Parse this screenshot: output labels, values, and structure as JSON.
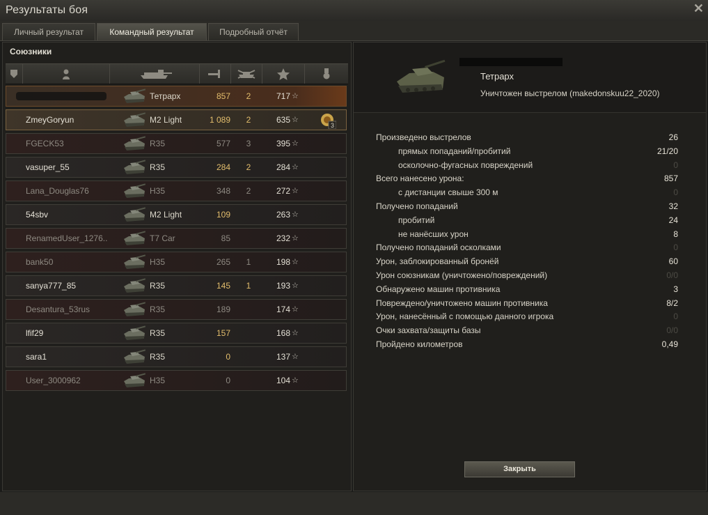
{
  "window": {
    "title": "Результаты боя",
    "close_glyph": "✕"
  },
  "tabs": [
    {
      "label": "Личный результат",
      "active": false
    },
    {
      "label": "Командный результат",
      "active": true
    },
    {
      "label": "Подробный отчёт",
      "active": false
    }
  ],
  "team": {
    "title": "Союзники",
    "columns": [
      "squad-icon",
      "player-icon",
      "tank-icon",
      "damage-icon",
      "kills-icon",
      "xp-icon",
      "medal-icon"
    ],
    "sort_glyph": "⌄",
    "star_glyph": "☆",
    "rows": [
      {
        "name": "",
        "tank": "Тетрарх",
        "damage": "857",
        "kills": "2",
        "xp": "717",
        "state": "self"
      },
      {
        "name": "ZmeyGoryun",
        "tank": "M2 Light",
        "damage": "1 089",
        "kills": "2",
        "xp": "635",
        "state": "hl",
        "medal": "3"
      },
      {
        "name": "FGECK53",
        "tank": "R35",
        "damage": "577",
        "kills": "3",
        "xp": "395",
        "state": "dead"
      },
      {
        "name": "vasuper_55",
        "tank": "R35",
        "damage": "284",
        "kills": "2",
        "xp": "284",
        "state": "alive"
      },
      {
        "name": "Lana_Douglas76",
        "tank": "H35",
        "damage": "348",
        "kills": "2",
        "xp": "272",
        "state": "dead"
      },
      {
        "name": "54sbv",
        "tank": "M2 Light",
        "damage": "109",
        "kills": "",
        "xp": "263",
        "state": "alive"
      },
      {
        "name": "RenamedUser_1276..",
        "tank": "T7 Car",
        "damage": "85",
        "kills": "",
        "xp": "232",
        "state": "dead"
      },
      {
        "name": "bank50",
        "tank": "H35",
        "damage": "265",
        "kills": "1",
        "xp": "198",
        "state": "dead"
      },
      {
        "name": "sanya777_85",
        "tank": "R35",
        "damage": "145",
        "kills": "1",
        "xp": "193",
        "state": "alive"
      },
      {
        "name": "Desantura_53rus",
        "tank": "R35",
        "damage": "189",
        "kills": "",
        "xp": "174",
        "state": "dead"
      },
      {
        "name": "lfif29",
        "tank": "R35",
        "damage": "157",
        "kills": "",
        "xp": "168",
        "state": "alive"
      },
      {
        "name": "sara1",
        "tank": "R35",
        "damage": "0",
        "kills": "",
        "xp": "137",
        "state": "alive"
      },
      {
        "name": "User_3000962",
        "tank": "H35",
        "damage": "0",
        "kills": "",
        "xp": "104",
        "state": "dead"
      }
    ]
  },
  "detail": {
    "vehicle": "Тетрарх",
    "status": "Уничтожен выстрелом (makedonskuu22_2020)",
    "stats": [
      {
        "label": "Произведено выстрелов",
        "value": "26",
        "indent": false,
        "dim": false
      },
      {
        "label": "прямых попаданий/пробитий",
        "value": "21/20",
        "indent": true,
        "dim": false
      },
      {
        "label": "осколочно-фугасных повреждений",
        "value": "0",
        "indent": true,
        "dim": true
      },
      {
        "label": "Всего нанесено урона:",
        "value": "857",
        "indent": false,
        "dim": false
      },
      {
        "label": "с дистанции свыше 300 м",
        "value": "0",
        "indent": true,
        "dim": true
      },
      {
        "label": "Получено попаданий",
        "value": "32",
        "indent": false,
        "dim": false
      },
      {
        "label": "пробитий",
        "value": "24",
        "indent": true,
        "dim": false
      },
      {
        "label": "не нанёсших урон",
        "value": "8",
        "indent": true,
        "dim": false
      },
      {
        "label": "Получено попаданий осколками",
        "value": "0",
        "indent": false,
        "dim": true
      },
      {
        "label": "Урон, заблокированный бронёй",
        "value": "60",
        "indent": false,
        "dim": false
      },
      {
        "label": "Урон союзникам (уничтожено/повреждений)",
        "value": "0/0",
        "indent": false,
        "dim": true
      },
      {
        "label": "Обнаружено машин противника",
        "value": "3",
        "indent": false,
        "dim": false
      },
      {
        "label": "Повреждено/уничтожено машин противника",
        "value": "8/2",
        "indent": false,
        "dim": false
      },
      {
        "label": "Урон, нанесённый с помощью данного игрока",
        "value": "0",
        "indent": false,
        "dim": true
      },
      {
        "label": "Очки захвата/защиты базы",
        "value": "0/0",
        "indent": false,
        "dim": true
      },
      {
        "label": "Пройдено километров",
        "value": "0,49",
        "indent": false,
        "dim": false
      }
    ],
    "close_label": "Закрыть"
  },
  "colors": {
    "accent": "#e2bd6c",
    "self_row": "#6a3a1a",
    "dead_row": "#2e201e"
  }
}
